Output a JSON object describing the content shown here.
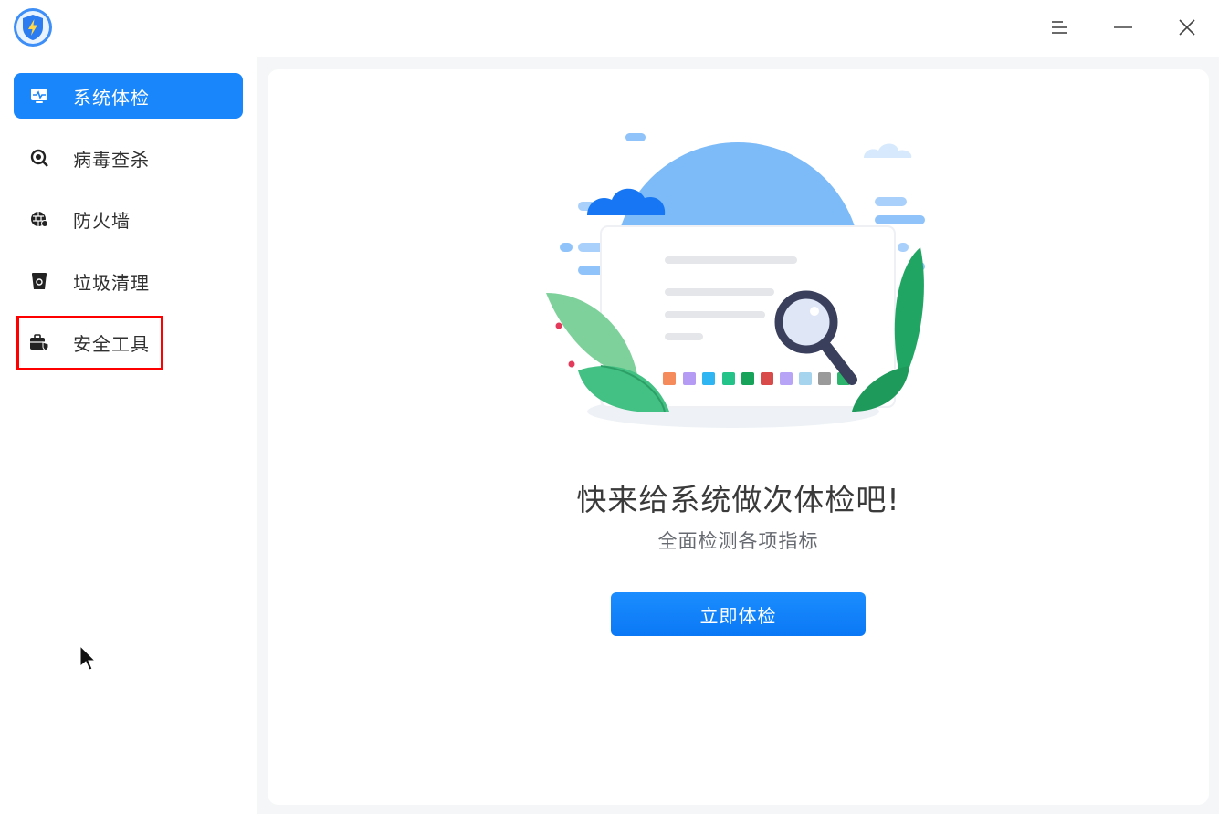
{
  "titlebar": {
    "logo_icon": "shield-lightning-icon",
    "menu_icon": "menu-icon",
    "minimize_icon": "minimize-icon",
    "close_icon": "close-icon"
  },
  "sidebar": {
    "items": [
      {
        "label": "系统体检",
        "icon": "monitor-pulse-icon",
        "active": true
      },
      {
        "label": "病毒查杀",
        "icon": "virus-scan-icon",
        "active": false
      },
      {
        "label": "防火墙",
        "icon": "firewall-icon",
        "active": false
      },
      {
        "label": "垃圾清理",
        "icon": "trash-icon",
        "active": false
      },
      {
        "label": "安全工具",
        "icon": "toolbox-icon",
        "active": false
      }
    ]
  },
  "main": {
    "headline": "快来给系统做次体检吧!",
    "subline": "全面检测各项指标",
    "button_label": "立即体检"
  },
  "colors": {
    "accent": "#1a86fb",
    "highlight": "#ff0000"
  }
}
